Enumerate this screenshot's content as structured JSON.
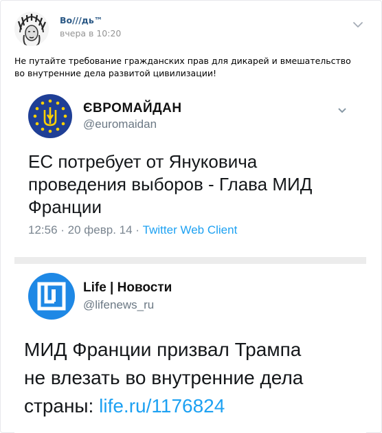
{
  "post": {
    "author_name": "Во///дь™",
    "time": "вчера в 10:20",
    "text": "Не путайте требование гражданских прав для дикарей и вмешательство во внутренние дела развитой цивилизации!",
    "menu_icon": "chevron-down-icon",
    "avatar_icon": "avatar"
  },
  "tweet1": {
    "name": "ЄВРОМАЙДАН",
    "handle": "@euromaidan",
    "body_line1": "ЕС потребует от Януковича",
    "body_line2": "проведения выборов - Глава МИД",
    "body_line3": "Франции",
    "time": "12:56 · 20 февр. 14 · ",
    "client": "Twitter Web Client",
    "logo_colors": {
      "background": "#1f3f96",
      "stars": "#ffd200"
    }
  },
  "tweet2": {
    "name": "Life | Новости",
    "handle": "@lifenews_ru",
    "body_line1": "МИД Франции призвал Трампа",
    "body_line2": "не влезать во внутренние дела",
    "body_line3_prefix": "страны: ",
    "link": "life.ru/1176824",
    "logo_colors": {
      "background": "#1e88e5",
      "foreground": "#ffffff"
    }
  },
  "colors": {
    "link_blue": "#2a5885",
    "twitter_blue": "#1da1f2",
    "muted": "#939393"
  }
}
